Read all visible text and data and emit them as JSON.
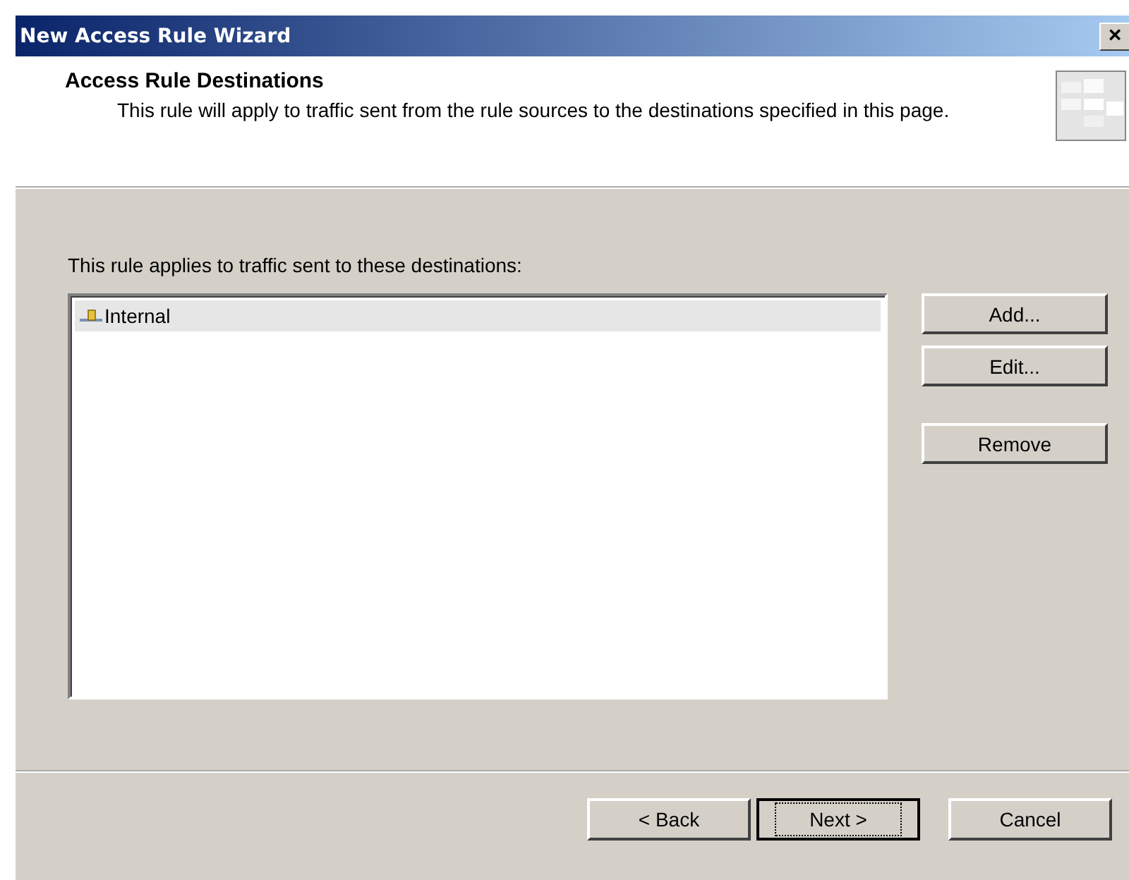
{
  "window": {
    "title": "New Access Rule Wizard",
    "close": "×"
  },
  "header": {
    "title": "Access Rule Destinations",
    "description": "This rule will apply to traffic sent from the rule sources to the destinations specified in this page."
  },
  "destinations": {
    "label": "This rule applies to traffic sent to these destinations:",
    "items": [
      {
        "name": "Internal",
        "selected": true
      }
    ]
  },
  "side_buttons": [
    "Add...",
    "Edit...",
    "Remove"
  ],
  "footer_buttons": [
    {
      "label": "< Back",
      "default": false
    },
    {
      "label": "Next >",
      "default": true
    },
    {
      "label": "Cancel",
      "default": false
    }
  ]
}
